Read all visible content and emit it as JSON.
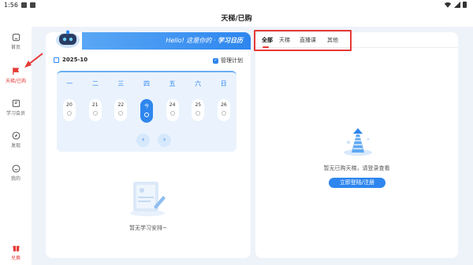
{
  "status": {
    "time": "1:56"
  },
  "title": "天梯/已购",
  "sidebar": {
    "items": [
      {
        "label": "首页",
        "icon": "home-icon"
      },
      {
        "label": "天梯/已购",
        "icon": "flag-icon",
        "active": true
      },
      {
        "label": "学习会员",
        "icon": "member-icon"
      },
      {
        "label": "发现",
        "icon": "compass-icon"
      },
      {
        "label": "我的",
        "icon": "face-icon"
      },
      {
        "label": "兑换",
        "icon": "gift-icon"
      }
    ]
  },
  "calendar": {
    "banner_prefix": "Hello! 这是你的 · ",
    "banner_title": "学习日历",
    "month": "2025-10",
    "manage_label": "管理计划",
    "weekdays": [
      "一",
      "二",
      "三",
      "四",
      "五",
      "六",
      "日"
    ],
    "days": [
      "20",
      "21",
      "22",
      "今",
      "24",
      "25",
      "26"
    ],
    "prev_arrow": "‹",
    "next_arrow": "›",
    "empty_text": "暂无学习安排~"
  },
  "tabs": [
    "全部",
    "天梯",
    "直播课",
    "其他"
  ],
  "purchased": {
    "empty_text": "暂无已购天梯，请登录查看",
    "login_label": "立即登陆/注册"
  },
  "colors": {
    "accent": "#2e86ee",
    "highlight": "#e53935"
  }
}
